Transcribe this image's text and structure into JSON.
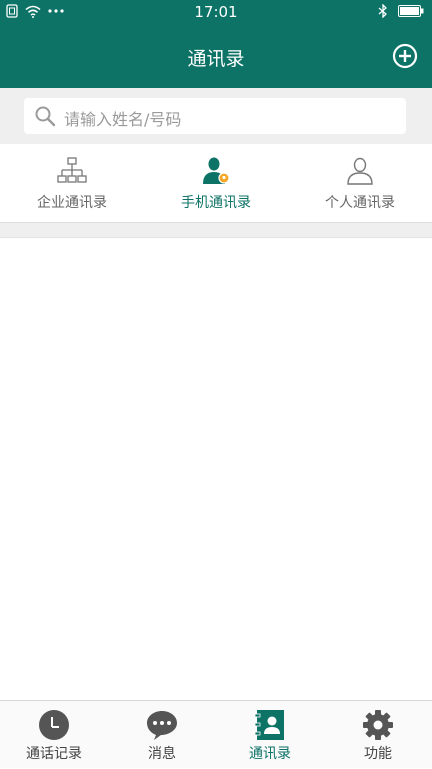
{
  "status": {
    "time": "17:01"
  },
  "header": {
    "title": "通讯录",
    "add_icon": "plus-circle-icon"
  },
  "search": {
    "placeholder": "请输入姓名/号码"
  },
  "tabs": [
    {
      "label": "企业通讯录",
      "icon": "org-chart-icon",
      "active": false
    },
    {
      "label": "手机通讯录",
      "icon": "phone-contact-icon",
      "active": true
    },
    {
      "label": "个人通讯录",
      "icon": "person-outline-icon",
      "active": false
    }
  ],
  "bottom_nav": [
    {
      "label": "通话记录",
      "icon": "clock-icon",
      "active": false
    },
    {
      "label": "消息",
      "icon": "chat-bubble-icon",
      "active": false
    },
    {
      "label": "通讯录",
      "icon": "contacts-book-icon",
      "active": true
    },
    {
      "label": "功能",
      "icon": "gear-icon",
      "active": false
    }
  ],
  "colors": {
    "primary": "#0d7366",
    "accent": "#f5a623",
    "inactive": "#666666"
  }
}
